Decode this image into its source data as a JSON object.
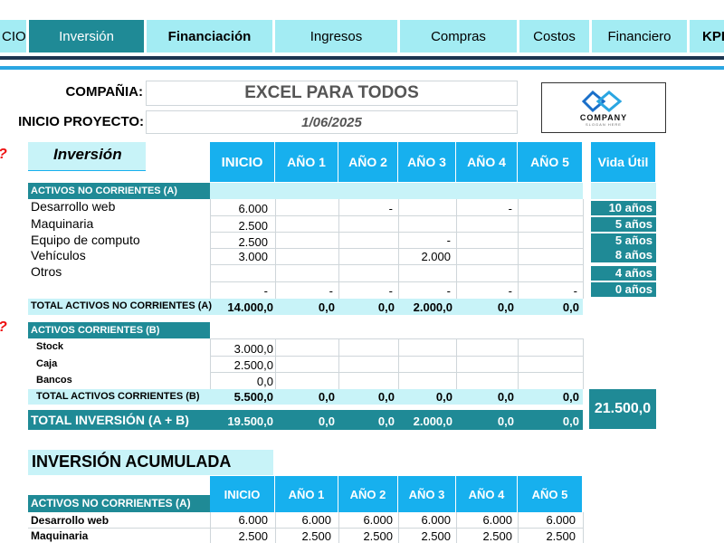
{
  "tabs": [
    {
      "label": "CIO",
      "active": false
    },
    {
      "label": "Inversión",
      "active": true
    },
    {
      "label": "Financiación",
      "active": false
    },
    {
      "label": "Ingresos",
      "active": false
    },
    {
      "label": "Compras",
      "active": false
    },
    {
      "label": "Costos",
      "active": false
    },
    {
      "label": "Financiero",
      "active": false
    },
    {
      "label": "KPI",
      "active": false
    }
  ],
  "header": {
    "company_label": "COMPAÑIA:",
    "company_value": "EXCEL PARA TODOS",
    "start_label": "INICIO PROYECTO:",
    "start_value": "1/06/2025",
    "logo_text": "COMPANY",
    "logo_tagline": "SLOGAN HERE"
  },
  "inversion": {
    "title": "Inversión",
    "columns": [
      "INICIO",
      "AÑO 1",
      "AÑO 2",
      "AÑO 3",
      "AÑO 4",
      "AÑO 5"
    ],
    "life_header": "Vida Útil",
    "section_a": "ACTIVOS NO CORRIENTES (A)",
    "rows_a": [
      {
        "name": "Desarrollo web",
        "vals": [
          "6.000",
          "",
          "-",
          "",
          "-",
          ""
        ],
        "life": "10 años"
      },
      {
        "name": "Maquinaria",
        "vals": [
          "2.500",
          "",
          "",
          "",
          "",
          ""
        ],
        "life": "5 años"
      },
      {
        "name": "Equipo de computo",
        "vals": [
          "2.500",
          "",
          "",
          "-",
          "",
          ""
        ],
        "life": "5 años"
      },
      {
        "name": "Vehículos",
        "vals": [
          "3.000",
          "",
          "",
          "2.000",
          "",
          ""
        ],
        "life": "8 años"
      },
      {
        "name": "Otros",
        "vals": [
          "",
          "",
          "",
          "",
          "",
          ""
        ],
        "life": "4 años"
      },
      {
        "name": "",
        "vals": [
          "-",
          "-",
          "-",
          "-",
          "-",
          "-"
        ],
        "life": "0 años"
      }
    ],
    "total_a_label": "TOTAL ACTIVOS NO CORRIENTES (A)",
    "total_a": [
      "14.000,0",
      "0,0",
      "0,0",
      "2.000,0",
      "0,0",
      "0,0"
    ],
    "section_b": "ACTIVOS CORRIENTES (B)",
    "rows_b": [
      {
        "name": "Stock",
        "val": "3.000,0"
      },
      {
        "name": "Caja",
        "val": "2.500,0"
      },
      {
        "name": "Bancos",
        "val": "0,0"
      }
    ],
    "total_b_label": "TOTAL ACTIVOS CORRIENTES (B)",
    "total_b": [
      "5.500,0",
      "0,0",
      "0,0",
      "0,0",
      "0,0",
      "0,0"
    ],
    "total_inv_label": "TOTAL INVERSIÓN (A + B)",
    "total_inv": [
      "19.500,0",
      "0,0",
      "0,0",
      "2.000,0",
      "0,0",
      "0,0"
    ],
    "grand_total": "21.500,0"
  },
  "acumulada": {
    "title": "INVERSIÓN ACUMULADA",
    "section": "ACTIVOS NO CORRIENTES (A)",
    "columns": [
      "INICIO",
      "AÑO 1",
      "AÑO 2",
      "AÑO 3",
      "AÑO 4",
      "AÑO 5"
    ],
    "rows": [
      {
        "name": "Desarrollo web",
        "vals": [
          "6.000",
          "6.000",
          "6.000",
          "6.000",
          "6.000",
          "6.000"
        ]
      },
      {
        "name": "Maquinaria",
        "vals": [
          "2.500",
          "2.500",
          "2.500",
          "2.500",
          "2.500",
          "2.500"
        ]
      }
    ]
  },
  "colors": {
    "teal": "#1f8a96",
    "cyan": "#17b0ee",
    "light": "#c8f3f8",
    "tab": "#a3ecf3",
    "navy": "#1c3550"
  }
}
